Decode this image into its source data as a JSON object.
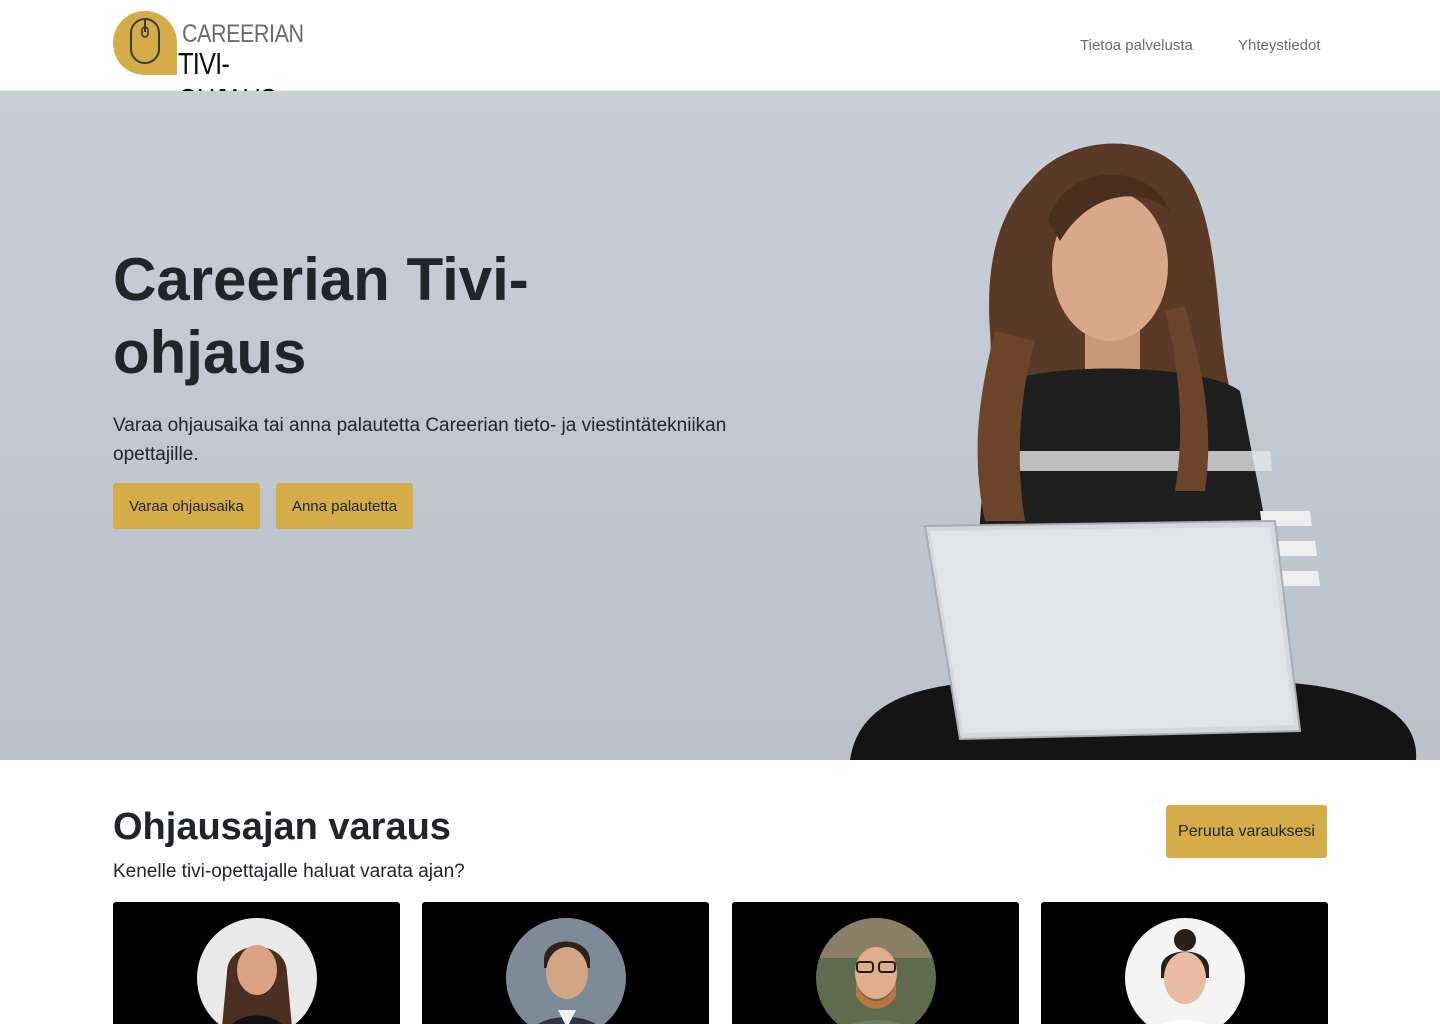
{
  "header": {
    "logo_line1": "CAREERIAN",
    "logo_line2": "TIVI-OHJAUS",
    "nav": {
      "about": "Tietoa palvelusta",
      "contact": "Yhteystiedot"
    }
  },
  "hero": {
    "title": "Careerian Tivi-ohjaus",
    "lead": "Varaa ohjausaika tai anna palautetta Careerian tieto- ja viestintätekniikan opettajille.",
    "book_label": "Varaa ohjausaika",
    "feedback_label": "Anna palautetta"
  },
  "booking": {
    "title": "Ohjausajan varaus",
    "subtitle": "Kenelle tivi-opettajalle haluat varata ajan?",
    "cancel_label": "Peruuta varauksesi"
  },
  "colors": {
    "accent": "#d4ac48",
    "card_bg": "#000000",
    "hero_bg": "#c4cad3"
  }
}
